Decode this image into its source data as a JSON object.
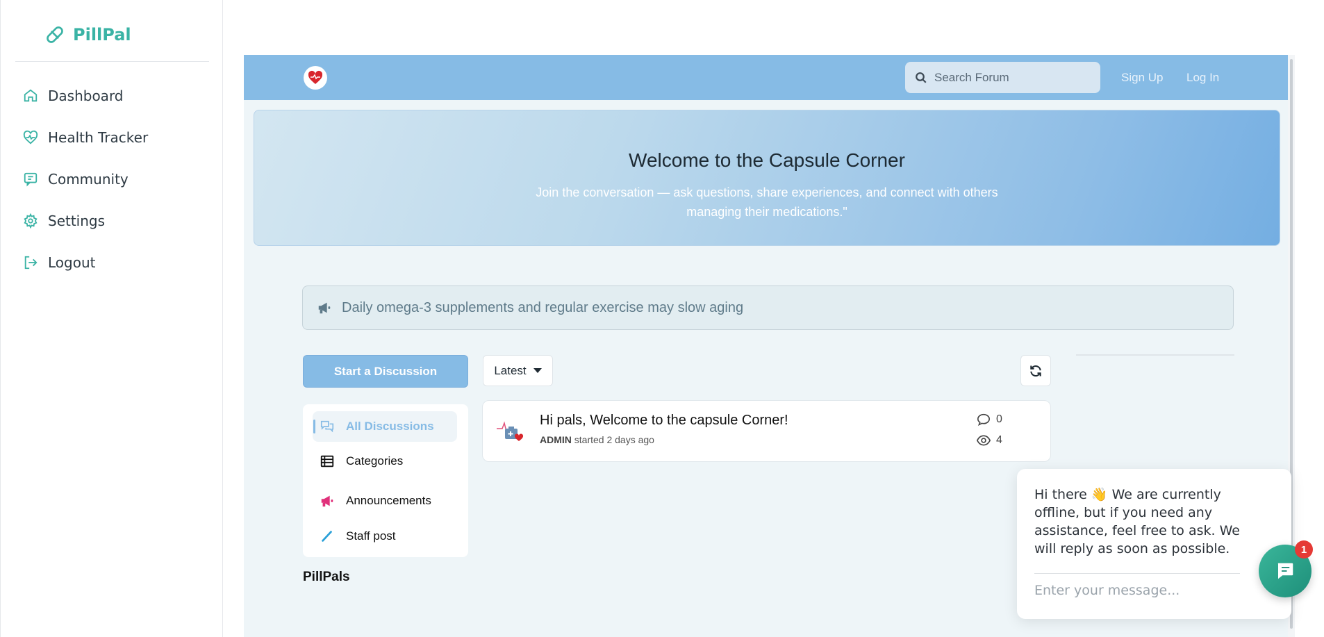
{
  "app": {
    "brand": "PillPal",
    "nav": [
      {
        "label": "Dashboard",
        "icon": "home-icon"
      },
      {
        "label": "Health Tracker",
        "icon": "heart-pulse-icon"
      },
      {
        "label": "Community",
        "icon": "chat-icon"
      },
      {
        "label": "Settings",
        "icon": "gear-icon"
      },
      {
        "label": "Logout",
        "icon": "logout-icon"
      }
    ]
  },
  "forum": {
    "search_placeholder": "Search Forum",
    "sign_up": "Sign Up",
    "log_in": "Log In",
    "hero": {
      "title": "Welcome to the Capsule Corner",
      "subtitle": "Join the conversation — ask questions, share experiences, and connect with others managing their medications.\""
    },
    "notice": "Daily omega-3 supplements and regular exercise may slow aging",
    "start_discussion": "Start a Discussion",
    "sort": "Latest",
    "categories": [
      {
        "label": "All Discussions",
        "icon": "discussions-icon",
        "active": true
      },
      {
        "label": "Categories",
        "icon": "list-icon"
      },
      {
        "label": "Announcements",
        "icon": "megaphone-icon",
        "color": "#e0307a"
      },
      {
        "label": "Staff post",
        "icon": "pencil-icon",
        "color": "#2aa0d8"
      }
    ],
    "group_title": "PillPals",
    "discussions": [
      {
        "title": "Hi pals, Welcome to the capsule Corner!",
        "author": "ADMIN",
        "meta": "started 2 days ago",
        "replies": "0",
        "views": "4"
      }
    ]
  },
  "chat": {
    "message": "Hi there 👋 We are currently offline, but if you need any assistance, feel free to ask. We will reply as soon as possible.",
    "input_placeholder": "Enter your message...",
    "badge": "1"
  },
  "colors": {
    "brand": "#3ab3a5",
    "forum_accent": "#86bbe5",
    "announcement": "#e0307a"
  }
}
